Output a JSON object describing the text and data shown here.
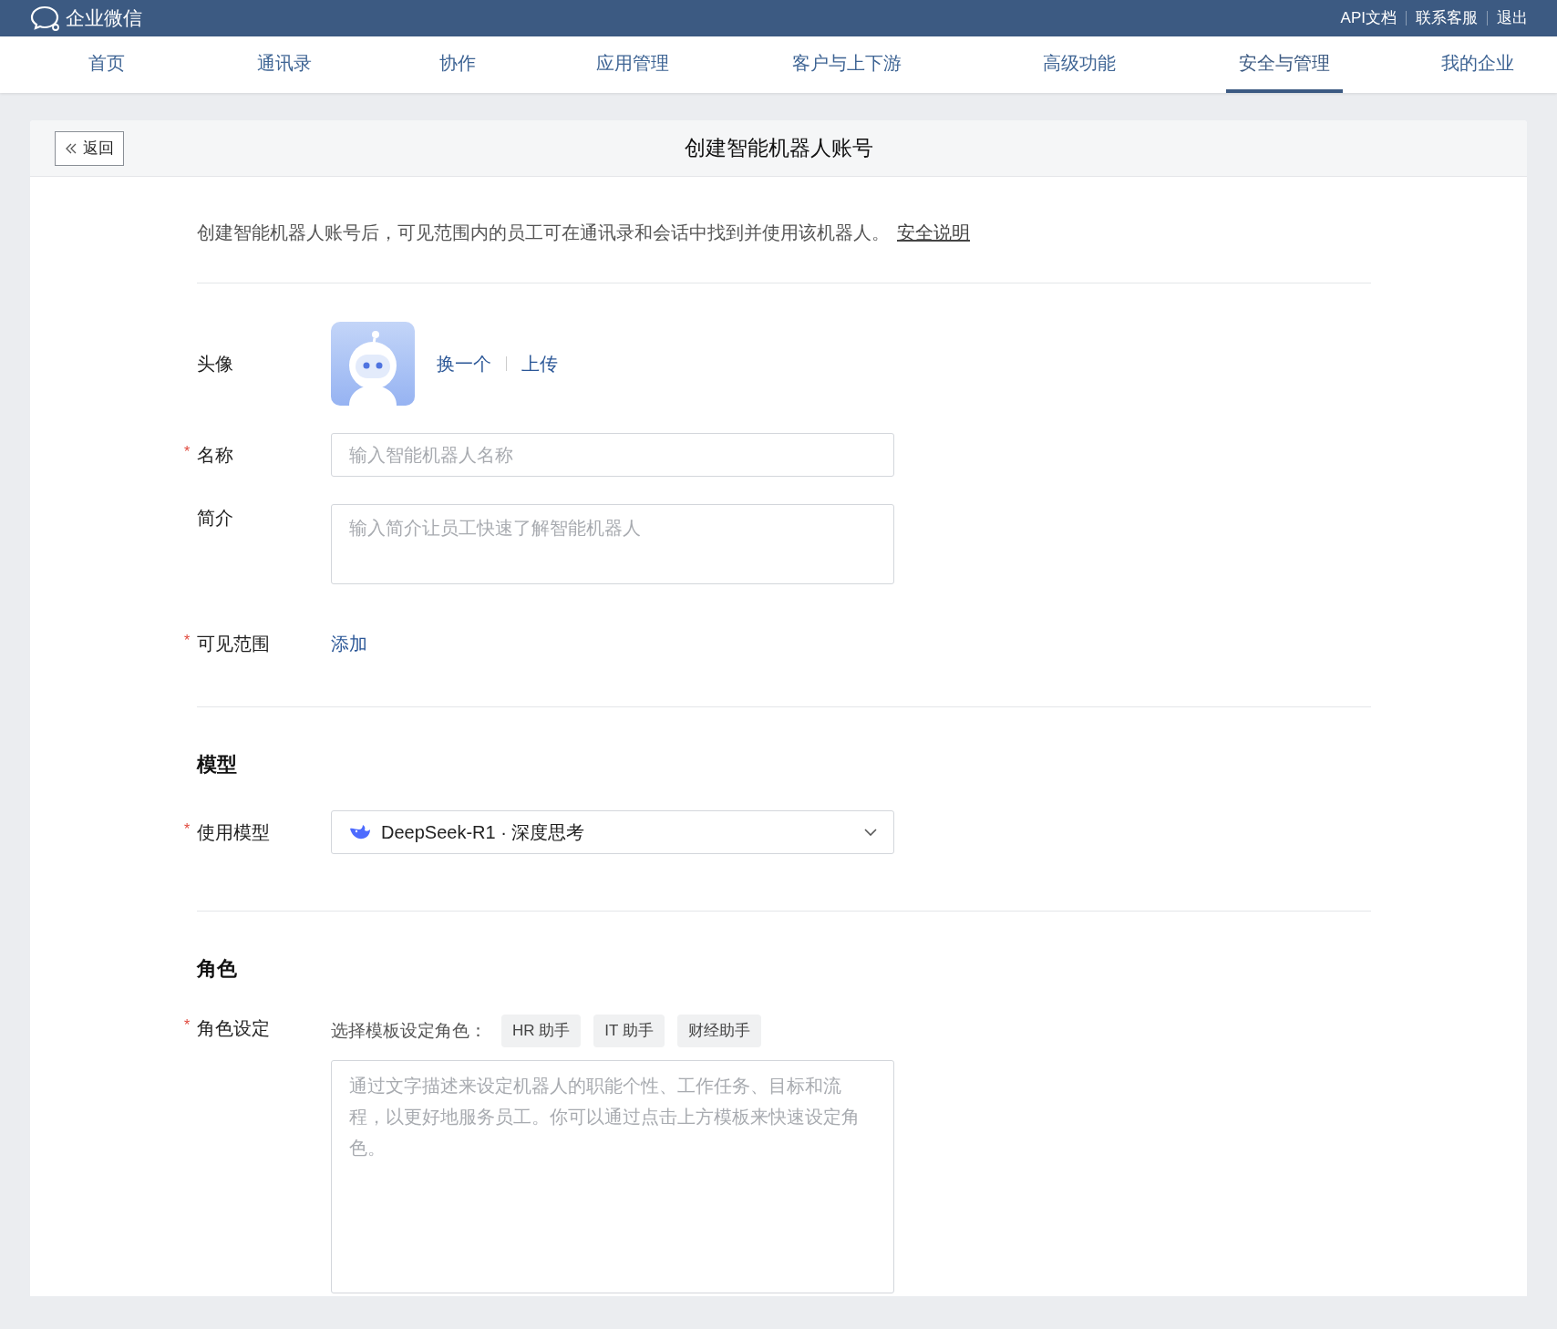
{
  "top_bar": {
    "logo_text": "企业微信",
    "links": [
      "API文档",
      "联系客服",
      "退出"
    ]
  },
  "nav_tabs": [
    {
      "label": "首页",
      "selected": false
    },
    {
      "label": "通讯录",
      "selected": false
    },
    {
      "label": "协作",
      "selected": false
    },
    {
      "label": "应用管理",
      "selected": false
    },
    {
      "label": "客户与上下游",
      "selected": false
    },
    {
      "label": "高级功能",
      "selected": false
    },
    {
      "label": "安全与管理",
      "selected": true
    },
    {
      "label": "我的企业",
      "selected": false
    }
  ],
  "page": {
    "back_button": "返回",
    "title": "创建智能机器人账号",
    "intro": "创建智能机器人账号后，可见范围内的员工可在通讯录和会话中找到并使用该机器人。",
    "intro_link": "安全说明"
  },
  "sections": [
    {
      "fields": [
        {
          "kind": "avatar",
          "label": "头像",
          "actions": [
            "换一个",
            "上传"
          ]
        },
        {
          "kind": "input",
          "label": "名称",
          "required_mark": "*",
          "placeholder": "输入智能机器人名称"
        },
        {
          "kind": "textarea",
          "label": "简介",
          "placeholder": "输入简介让员工快速了解智能机器人"
        },
        {
          "kind": "link",
          "label": "可见范围",
          "required_mark": "*",
          "value": "添加"
        }
      ]
    },
    {
      "title": "模型",
      "fields": [
        {
          "kind": "select",
          "label": "使用模型",
          "required_mark": "*",
          "value": "DeepSeek-R1 · 深度思考"
        }
      ]
    },
    {
      "title": "角色",
      "fields": [
        {
          "kind": "template",
          "label": "角色设定",
          "required_mark": "*",
          "prompt": "选择模板设定角色：",
          "templates": [
            "HR 助手",
            "IT 助手",
            "财经助手"
          ],
          "placeholder": "通过文字描述来设定机器人的职能个性、工作任务、目标和流程，以更好地服务员工。你可以通过点击上方模板来快速设定角色。"
        }
      ]
    }
  ]
}
